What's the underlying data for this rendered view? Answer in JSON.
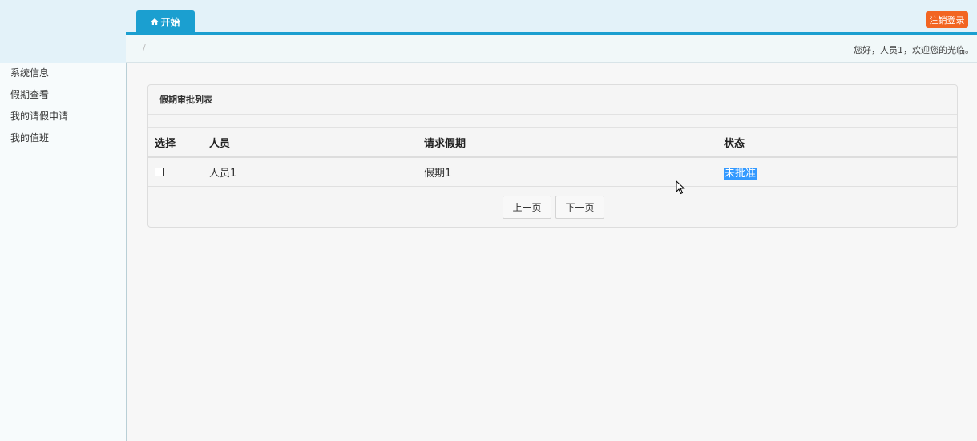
{
  "header": {
    "tabs": [
      {
        "label": "开始",
        "icon": "home-icon"
      }
    ],
    "logout_label": "注销登录",
    "breadcrumb_separator": "/",
    "welcome_text": "您好，人员1，欢迎您的光临。",
    "colors": {
      "tab": "#1b9fd0",
      "logout": "#f26522",
      "selection": "#3399ff"
    }
  },
  "sidebar": {
    "items": [
      {
        "label": "系统信息"
      },
      {
        "label": "假期查看"
      },
      {
        "label": "我的请假申请"
      },
      {
        "label": "我的值班"
      }
    ]
  },
  "panel": {
    "title": "假期审批列表",
    "columns": [
      "选择",
      "人员",
      "请求假期",
      "状态"
    ],
    "rows": [
      {
        "checked": false,
        "person": "人员1",
        "leave": "假期1",
        "status": "未批准"
      }
    ]
  },
  "pager": {
    "prev_label": "上一页",
    "next_label": "下一页"
  }
}
